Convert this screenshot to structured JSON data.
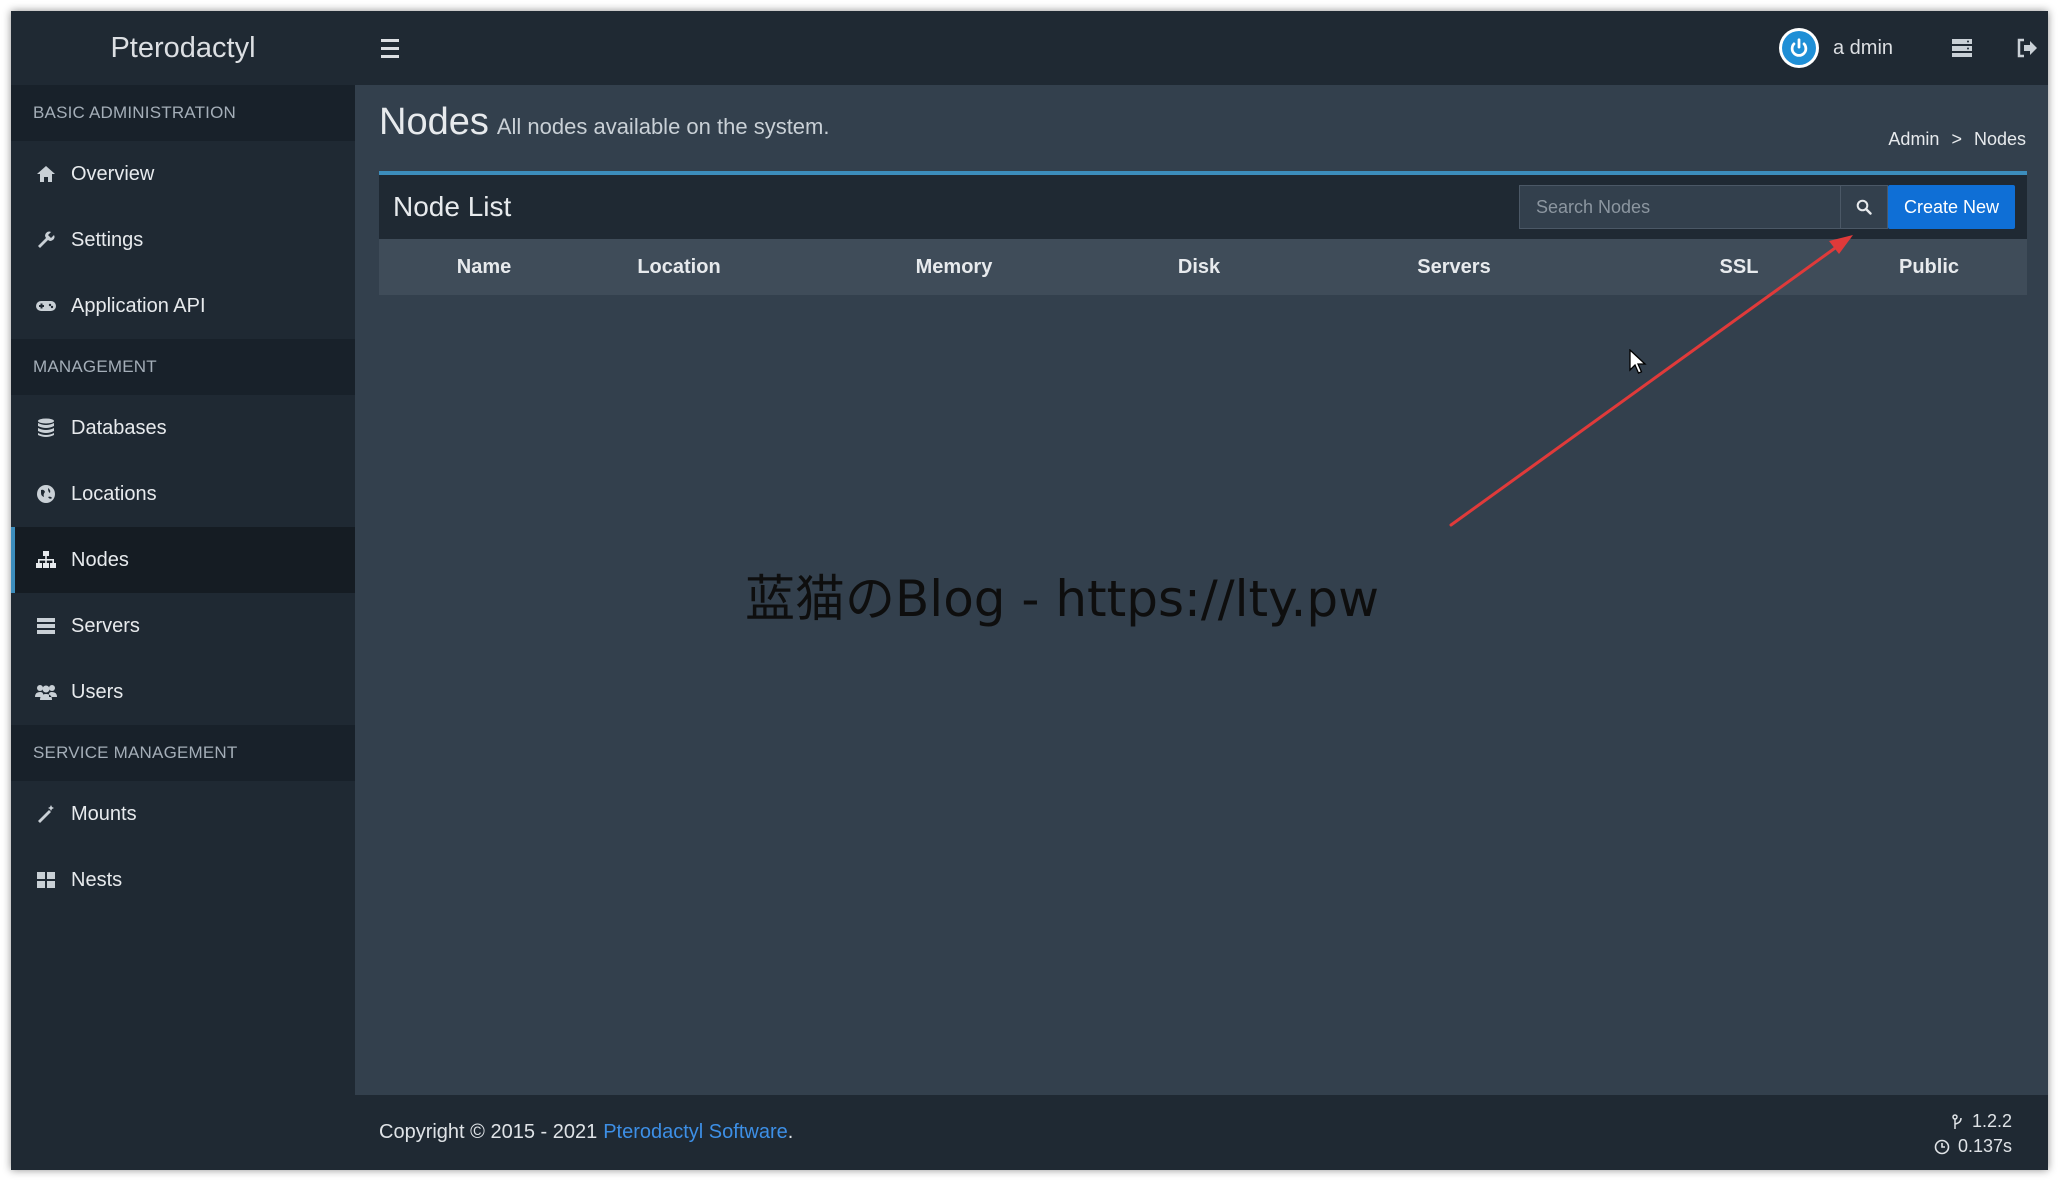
{
  "header": {
    "brand": "Pterodactyl",
    "user_name": "a dmin"
  },
  "sidebar": {
    "sections": [
      {
        "title": "BASIC ADMINISTRATION",
        "items": [
          {
            "label": "Overview",
            "icon": "home-icon"
          },
          {
            "label": "Settings",
            "icon": "wrench-icon"
          },
          {
            "label": "Application API",
            "icon": "gamepad-icon"
          }
        ]
      },
      {
        "title": "MANAGEMENT",
        "items": [
          {
            "label": "Databases",
            "icon": "database-icon"
          },
          {
            "label": "Locations",
            "icon": "globe-icon"
          },
          {
            "label": "Nodes",
            "icon": "sitemap-icon",
            "active": true
          },
          {
            "label": "Servers",
            "icon": "server-icon"
          },
          {
            "label": "Users",
            "icon": "users-icon"
          }
        ]
      },
      {
        "title": "SERVICE MANAGEMENT",
        "items": [
          {
            "label": "Mounts",
            "icon": "magic-icon"
          },
          {
            "label": "Nests",
            "icon": "th-large-icon"
          }
        ]
      }
    ]
  },
  "content": {
    "title": "Nodes",
    "subtitle": "All nodes available on the system.",
    "breadcrumb": [
      "Admin",
      ">",
      "Nodes"
    ]
  },
  "node_list": {
    "title": "Node List",
    "search_placeholder": "Search Nodes",
    "create_label": "Create New",
    "columns": [
      "Name",
      "Location",
      "Memory",
      "Disk",
      "Servers",
      "SSL",
      "Public"
    ],
    "rows": []
  },
  "watermark": "蓝猫のBlog - https://lty.pw",
  "footer": {
    "copyright": "Copyright © 2015 - 2021",
    "link_text": "Pterodactyl Software",
    "link_suffix": ".",
    "version": "1.2.2",
    "time": "0.137s"
  },
  "colors": {
    "accent": "#3c8dbc",
    "primary_button": "#0f6fd6",
    "annotation_arrow": "#e03a3a"
  }
}
